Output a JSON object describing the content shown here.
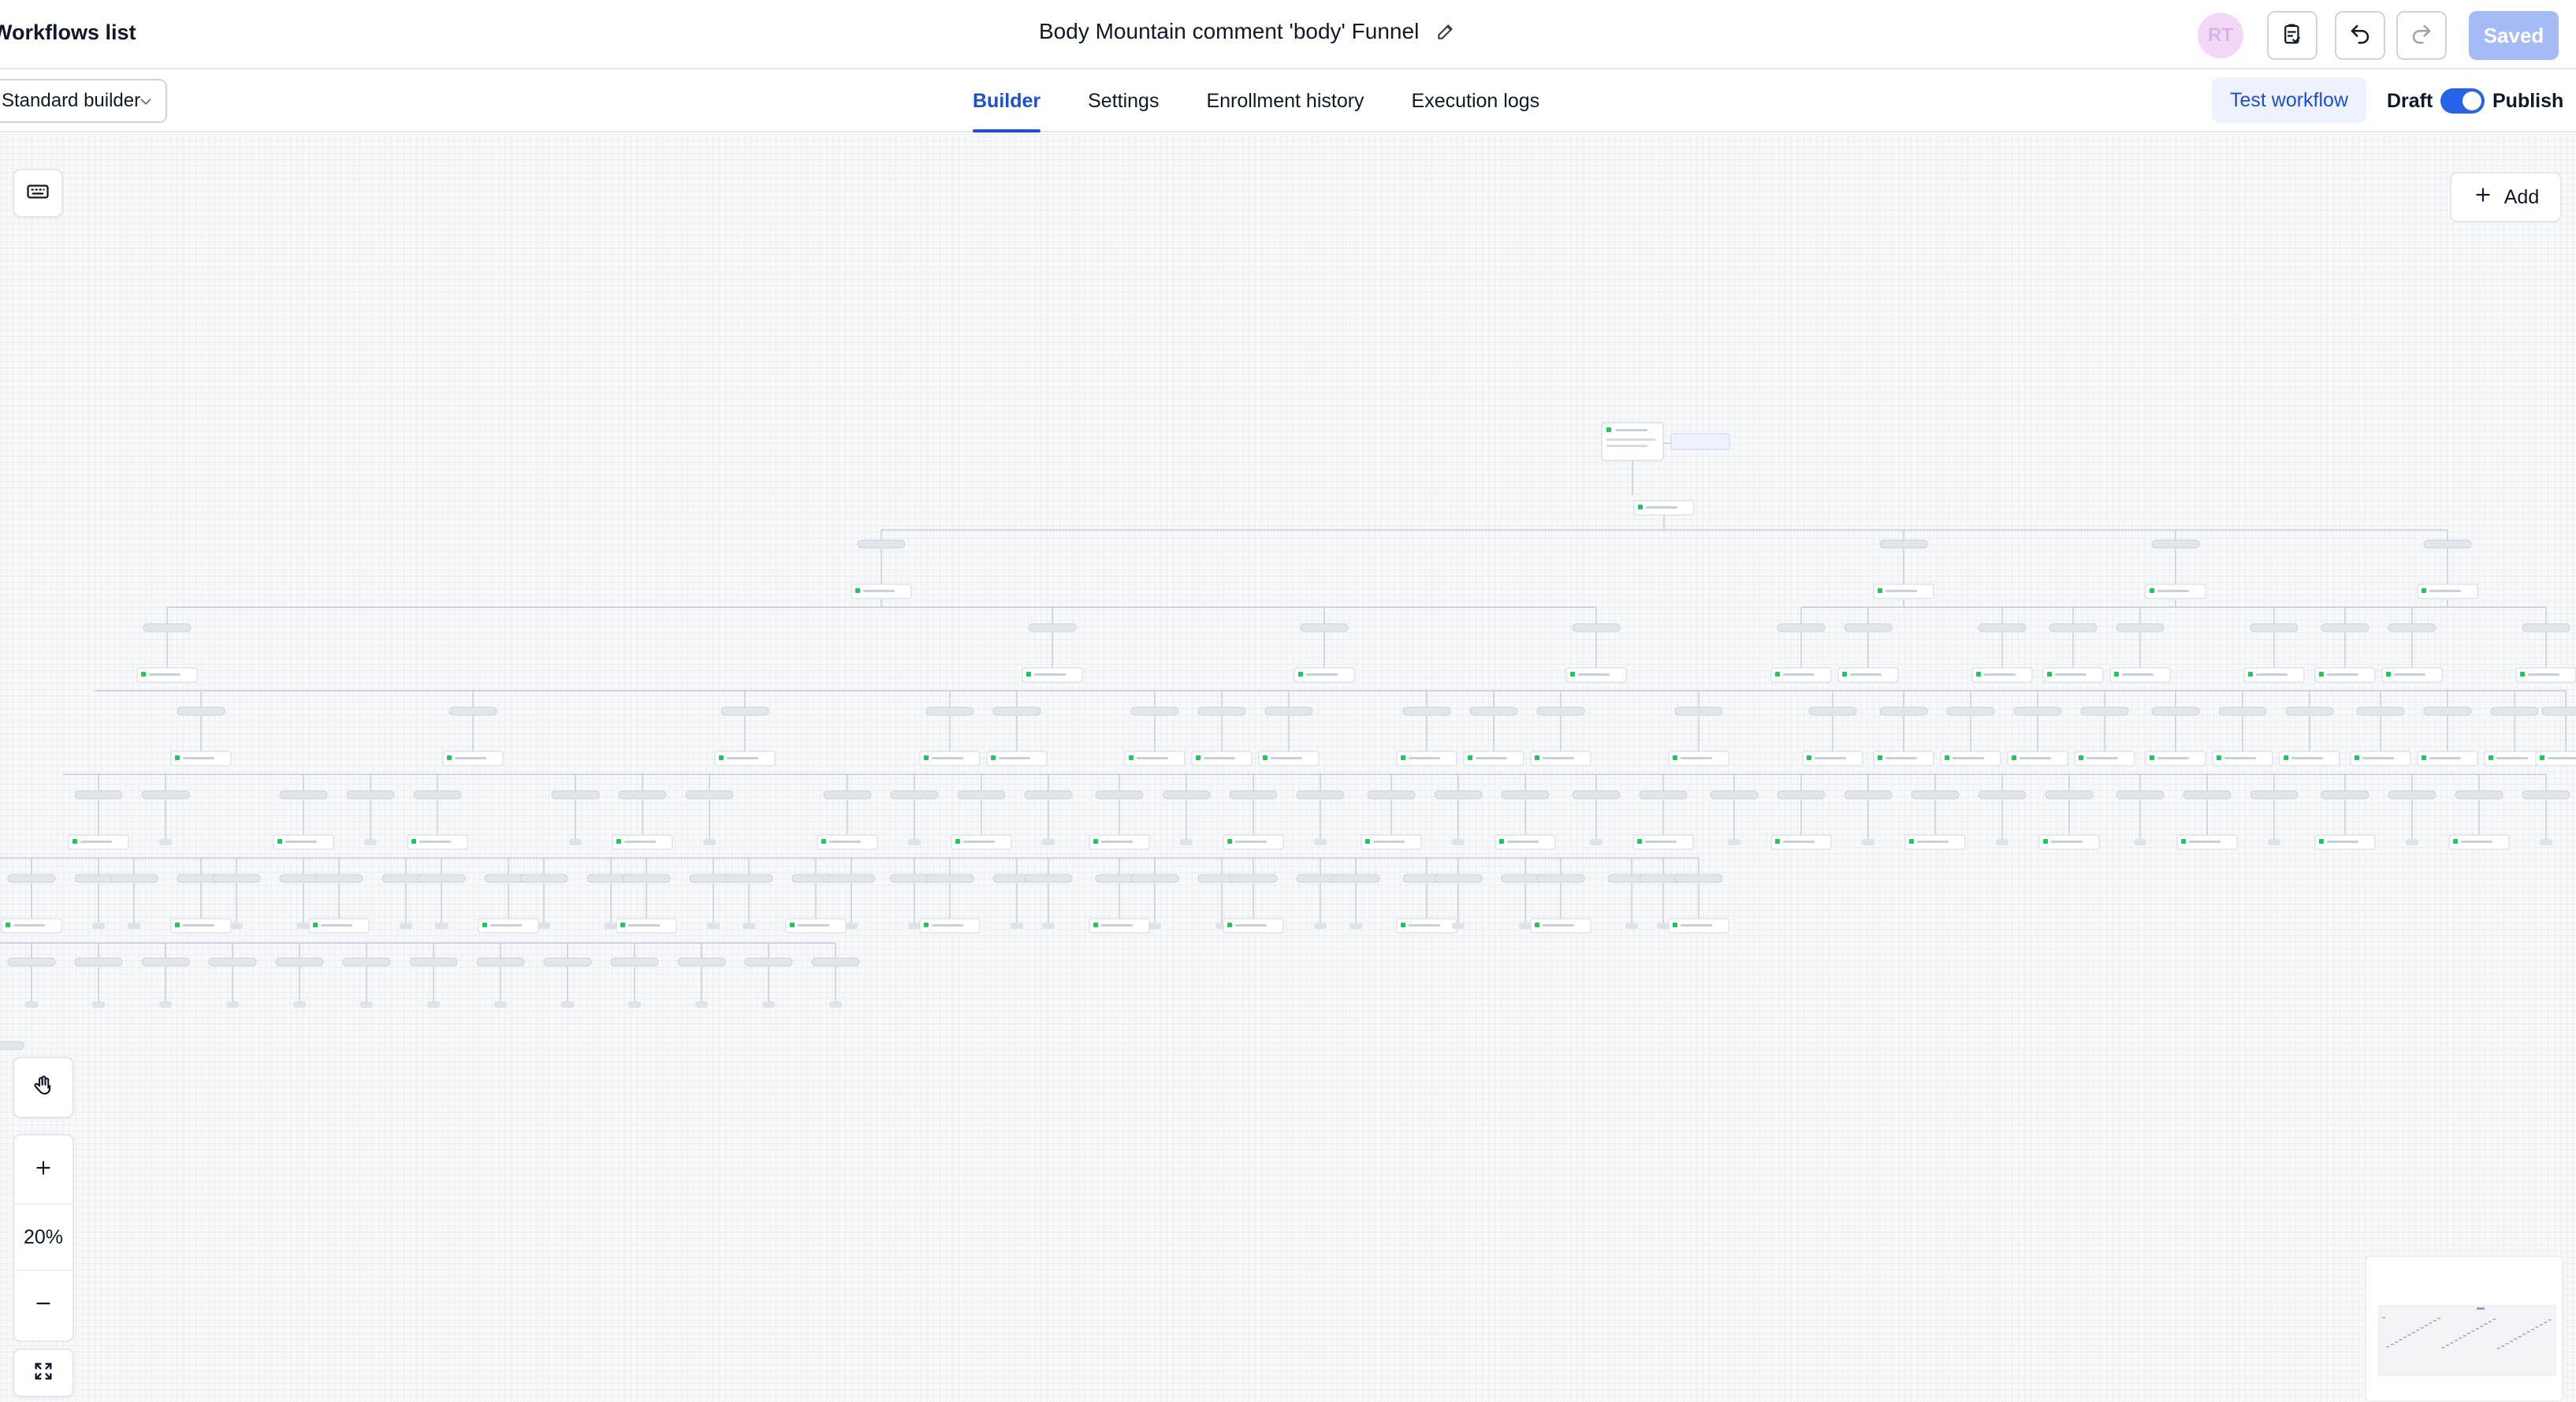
{
  "header": {
    "back_label": "Workflows list",
    "workflow_title": "Body Mountain comment 'body' Funnel",
    "avatar_initials": "RT",
    "saved_label": "Saved"
  },
  "subbar": {
    "builder_select_value": "Standard builder",
    "tabs": [
      {
        "label": "Builder",
        "active": true
      },
      {
        "label": "Settings",
        "active": false
      },
      {
        "label": "Enrollment history",
        "active": false
      },
      {
        "label": "Execution logs",
        "active": false
      }
    ],
    "test_workflow_label": "Test workflow",
    "draft_label": "Draft",
    "publish_label": "Publish",
    "publish_toggle_on": true
  },
  "canvas": {
    "add_label": "Add",
    "zoom_level": "20%"
  },
  "colors": {
    "accent": "#1d4ed8",
    "saved_bg": "#a5bbf5",
    "avatar_bg": "#f3d7f7",
    "node_dot": "#22c55e"
  },
  "icons": {
    "edit": "pencil-icon",
    "checklist": "clipboard-check-icon",
    "undo": "undo-icon",
    "redo": "redo-icon",
    "keyboard": "keyboard-icon",
    "add": "plus-icon",
    "pan": "hand-icon",
    "zoom_in": "plus-icon",
    "zoom_out": "minus-icon",
    "fit": "expand-icon"
  }
}
